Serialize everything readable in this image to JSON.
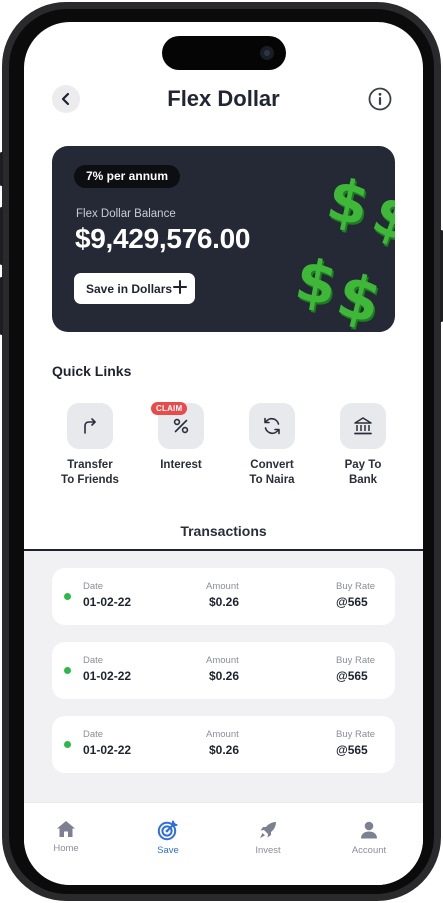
{
  "header": {
    "title": "Flex Dollar"
  },
  "balance_card": {
    "rate_badge": "7% per annum",
    "balance_label": "Flex Dollar Balance",
    "balance_value": "$9,429,576.00",
    "save_button_label": "Save in Dollars",
    "decor_symbol": "$",
    "decor_color": "#3fb83a"
  },
  "quick_links": {
    "title": "Quick Links",
    "items": [
      {
        "label": "Transfer\nTo Friends",
        "icon": "share-arrow-icon"
      },
      {
        "label": "Interest",
        "icon": "percent-icon",
        "badge": "CLAIM"
      },
      {
        "label": "Convert\nTo Naira",
        "icon": "refresh-icon"
      },
      {
        "label": "Pay To\nBank",
        "icon": "bank-icon"
      }
    ]
  },
  "transactions": {
    "title": "Transactions",
    "column_labels": {
      "date": "Date",
      "amount": "Amount",
      "rate": "Buy Rate"
    },
    "rows": [
      {
        "date": "01-02-22",
        "amount": "$0.26",
        "rate": "@565",
        "status_color": "#2db84a"
      },
      {
        "date": "01-02-22",
        "amount": "$0.26",
        "rate": "@565",
        "status_color": "#2db84a"
      },
      {
        "date": "01-02-22",
        "amount": "$0.26",
        "rate": "@565",
        "status_color": "#2db84a"
      }
    ]
  },
  "tabbar": {
    "active": "Save",
    "active_color": "#2f6fe0",
    "items": [
      {
        "label": "Home",
        "icon": "home-icon"
      },
      {
        "label": "Save",
        "icon": "target-icon"
      },
      {
        "label": "Invest",
        "icon": "rocket-icon"
      },
      {
        "label": "Account",
        "icon": "user-icon"
      }
    ]
  }
}
